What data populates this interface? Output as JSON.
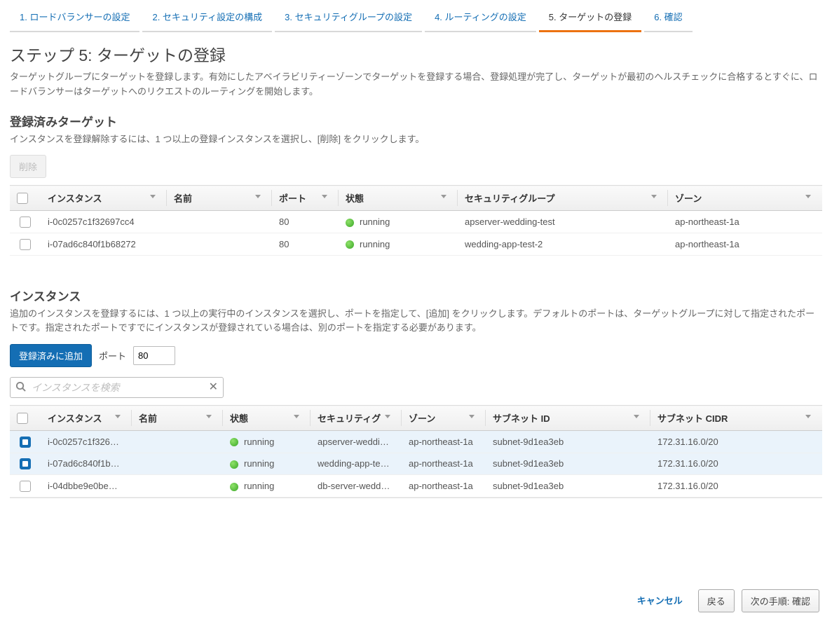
{
  "wizard": {
    "steps": [
      {
        "label": "1. ロードバランサーの設定",
        "active": false
      },
      {
        "label": "2. セキュリティ設定の構成",
        "active": false
      },
      {
        "label": "3. セキュリティグループの設定",
        "active": false
      },
      {
        "label": "4. ルーティングの設定",
        "active": false
      },
      {
        "label": "5. ターゲットの登録",
        "active": true
      },
      {
        "label": "6. 確認",
        "active": false
      }
    ]
  },
  "page": {
    "title": "ステップ 5: ターゲットの登録",
    "description": "ターゲットグループにターゲットを登録します。有効にしたアベイラビリティーゾーンでターゲットを登録する場合、登録処理が完了し、ターゲットが最初のヘルスチェックに合格するとすぐに、ロードバランサーはターゲットへのリクエストのルーティングを開始します。"
  },
  "registered": {
    "title": "登録済みターゲット",
    "description": "インスタンスを登録解除するには、1 つ以上の登録インスタンスを選択し、[削除] をクリックします。",
    "remove_btn": "削除",
    "headers": {
      "instance": "インスタンス",
      "name": "名前",
      "port": "ポート",
      "state": "状態",
      "sg": "セキュリティグループ",
      "zone": "ゾーン"
    },
    "rows": [
      {
        "checked": false,
        "instance": "i-0c0257c1f32697cc4",
        "name": "",
        "port": "80",
        "state": "running",
        "sg": "apserver-wedding-test",
        "zone": "ap-northeast-1a"
      },
      {
        "checked": false,
        "instance": "i-07ad6c840f1b68272",
        "name": "",
        "port": "80",
        "state": "running",
        "sg": "wedding-app-test-2",
        "zone": "ap-northeast-1a"
      }
    ]
  },
  "instances": {
    "title": "インスタンス",
    "description": "追加のインスタンスを登録するには、1 つ以上の実行中のインスタンスを選択し、ポートを指定して、[追加] をクリックします。デフォルトのポートは、ターゲットグループに対して指定されたポートです。指定されたポートですでにインスタンスが登録されている場合は、別のポートを指定する必要があります。",
    "add_btn": "登録済みに追加",
    "port_label": "ポート",
    "port_value": "80",
    "search_placeholder": "インスタンスを検索",
    "headers": {
      "instance": "インスタンス",
      "name": "名前",
      "state": "状態",
      "sg": "セキュリティグ",
      "zone": "ゾーン",
      "subnet_id": "サブネット ID",
      "subnet_cidr": "サブネット CIDR"
    },
    "rows": [
      {
        "checked": true,
        "instance": "i-0c0257c1f326…",
        "name": "",
        "state": "running",
        "sg": "apserver-weddi…",
        "zone": "ap-northeast-1a",
        "subnet_id": "subnet-9d1ea3eb",
        "subnet_cidr": "172.31.16.0/20"
      },
      {
        "checked": true,
        "instance": "i-07ad6c840f1b…",
        "name": "",
        "state": "running",
        "sg": "wedding-app-te…",
        "zone": "ap-northeast-1a",
        "subnet_id": "subnet-9d1ea3eb",
        "subnet_cidr": "172.31.16.0/20"
      },
      {
        "checked": false,
        "instance": "i-04dbbe9e0be…",
        "name": "",
        "state": "running",
        "sg": "db-server-wedd…",
        "zone": "ap-northeast-1a",
        "subnet_id": "subnet-9d1ea3eb",
        "subnet_cidr": "172.31.16.0/20"
      }
    ]
  },
  "footer": {
    "cancel": "キャンセル",
    "back": "戻る",
    "next": "次の手順: 確認"
  }
}
